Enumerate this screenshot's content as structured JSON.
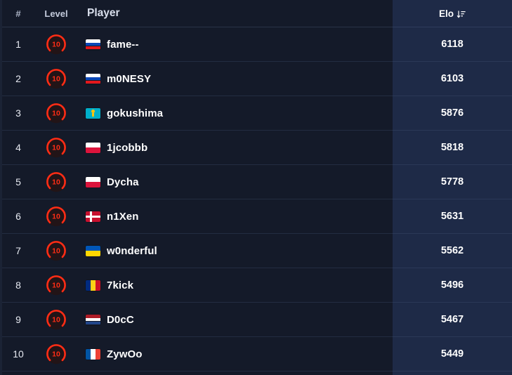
{
  "theme": {
    "page_bg": "#141a29",
    "elo_column_bg": "#1e2a47",
    "row_divider": "#232c41",
    "text_primary": "#ffffff",
    "level_accent": "#ff2d16"
  },
  "table": {
    "columns": [
      {
        "key": "rank",
        "label": "#"
      },
      {
        "key": "level",
        "label": "Level"
      },
      {
        "key": "player",
        "label": "Player"
      },
      {
        "key": "elo",
        "label": "Elo",
        "sort_icon": "sort-descending-icon",
        "sorted": "descending"
      }
    ],
    "rows": [
      {
        "rank": "1",
        "level": "10",
        "country": "Russia",
        "player": "fame--",
        "elo": "6118"
      },
      {
        "rank": "2",
        "level": "10",
        "country": "Russia",
        "player": "m0NESY",
        "elo": "6103"
      },
      {
        "rank": "3",
        "level": "10",
        "country": "Kazakhstan",
        "player": "gokushima",
        "elo": "5876"
      },
      {
        "rank": "4",
        "level": "10",
        "country": "Poland",
        "player": "1jcobbb",
        "elo": "5818"
      },
      {
        "rank": "5",
        "level": "10",
        "country": "Poland",
        "player": "Dycha",
        "elo": "5778"
      },
      {
        "rank": "6",
        "level": "10",
        "country": "Denmark",
        "player": "n1Xen",
        "elo": "5631"
      },
      {
        "rank": "7",
        "level": "10",
        "country": "Ukraine",
        "player": "w0nderful",
        "elo": "5562"
      },
      {
        "rank": "8",
        "level": "10",
        "country": "Romania",
        "player": "7kick",
        "elo": "5496"
      },
      {
        "rank": "9",
        "level": "10",
        "country": "Netherlands",
        "player": "D0cC",
        "elo": "5467"
      },
      {
        "rank": "10",
        "level": "10",
        "country": "France",
        "player": "ZywOo",
        "elo": "5449"
      }
    ]
  }
}
